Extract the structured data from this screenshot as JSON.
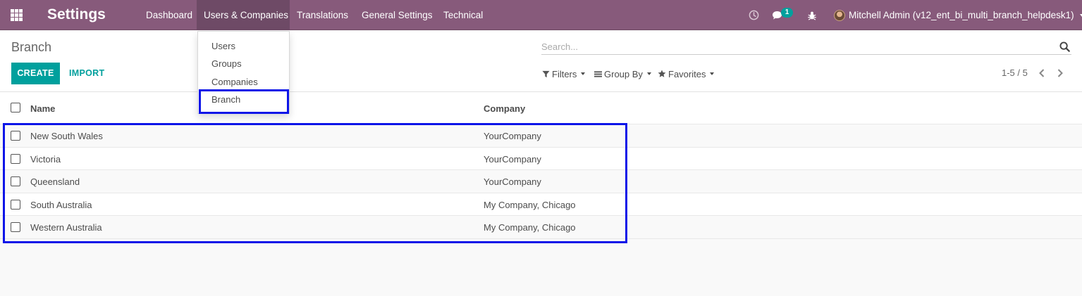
{
  "app": {
    "title": "Settings"
  },
  "menu": [
    "Dashboard",
    "Users & Companies",
    "Translations",
    "General Settings",
    "Technical"
  ],
  "systray": {
    "chat_count": "1"
  },
  "user": {
    "name": "Mitchell Admin (v12_ent_bi_multi_branch_helpdesk1)"
  },
  "breadcrumb": "Branch",
  "buttons": {
    "create": "CREATE",
    "import": "IMPORT"
  },
  "search": {
    "placeholder": "Search..."
  },
  "filters": {
    "filters": "Filters",
    "group_by": "Group By",
    "favorites": "Favorites"
  },
  "pager": {
    "value": "1-5 / 5"
  },
  "columns": {
    "name": "Name",
    "company": "Company"
  },
  "rows": [
    {
      "name": "New South Wales",
      "company": "YourCompany"
    },
    {
      "name": "Victoria",
      "company": "YourCompany"
    },
    {
      "name": "Queensland",
      "company": "YourCompany"
    },
    {
      "name": "South Australia",
      "company": "My Company, Chicago"
    },
    {
      "name": "Western Australia",
      "company": "My Company, Chicago"
    }
  ],
  "dropdown": [
    "Users",
    "Groups",
    "Companies",
    "Branch"
  ],
  "colors": {
    "navbar": "#875a7b",
    "accent": "#00a09d",
    "highlight": "#0d15e8"
  },
  "icons": [
    "apps-grid-icon",
    "clock-icon",
    "chat-icon",
    "bug-icon",
    "search-icon",
    "filter-icon",
    "list-icon",
    "star-icon",
    "chevron-left-icon",
    "chevron-right-icon"
  ]
}
